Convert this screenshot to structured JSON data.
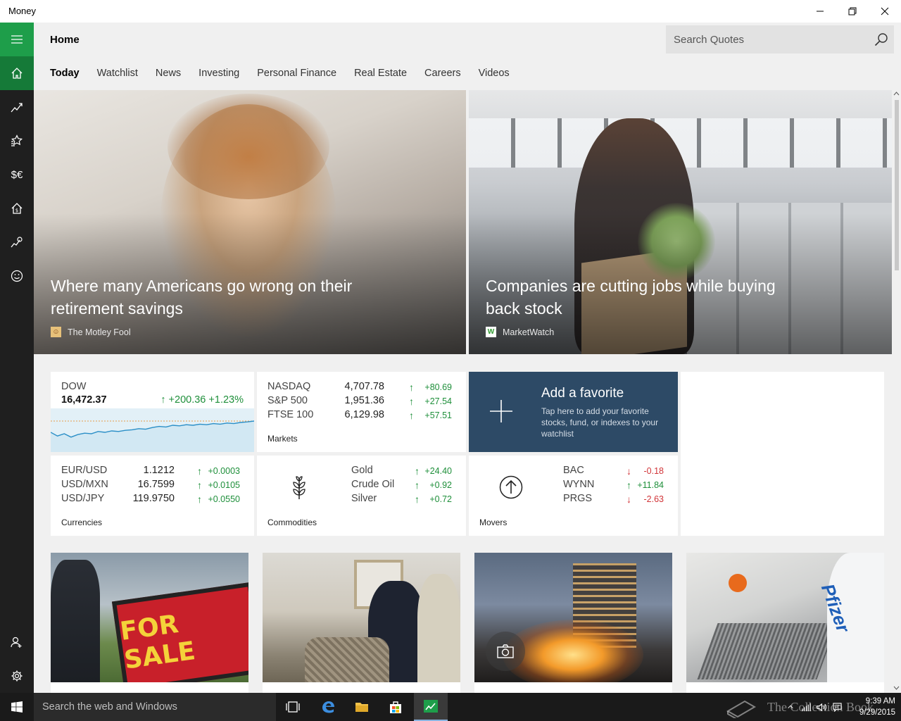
{
  "window": {
    "title": "Money"
  },
  "header": {
    "page_title": "Home"
  },
  "search": {
    "placeholder": "Search Quotes"
  },
  "tabs": [
    {
      "label": "Today",
      "active": true
    },
    {
      "label": "Watchlist"
    },
    {
      "label": "News"
    },
    {
      "label": "Investing"
    },
    {
      "label": "Personal Finance"
    },
    {
      "label": "Real Estate"
    },
    {
      "label": "Careers"
    },
    {
      "label": "Videos"
    }
  ],
  "hero": [
    {
      "headline": "Where many Americans go wrong on their retirement savings",
      "source": "The Motley Fool"
    },
    {
      "headline": "Companies are cutting jobs while buying back stock",
      "source": "MarketWatch"
    }
  ],
  "dow": {
    "name": "DOW",
    "value": "16,472.37",
    "change": "+200.36",
    "percent": "+1.23%",
    "sparkline": [
      0.55,
      0.42,
      0.5,
      0.38,
      0.47,
      0.52,
      0.5,
      0.58,
      0.55,
      0.6,
      0.58,
      0.62,
      0.64,
      0.68,
      0.66,
      0.72,
      0.76,
      0.74,
      0.8,
      0.78,
      0.82,
      0.8,
      0.84,
      0.82,
      0.86,
      0.84,
      0.88,
      0.86,
      0.9,
      0.92,
      0.95
    ]
  },
  "markets": {
    "caption": "Markets",
    "rows": [
      {
        "name": "NASDAQ",
        "value": "4,707.78",
        "change": "+80.69",
        "dir": "up"
      },
      {
        "name": "S&P 500",
        "value": "1,951.36",
        "change": "+27.54",
        "dir": "up"
      },
      {
        "name": "FTSE 100",
        "value": "6,129.98",
        "change": "+57.51",
        "dir": "up"
      }
    ]
  },
  "favorite": {
    "title": "Add a favorite",
    "description": "Tap here to add your favorite stocks, fund, or indexes to your watchlist"
  },
  "currencies": {
    "caption": "Currencies",
    "rows": [
      {
        "name": "EUR/USD",
        "value": "1.1212",
        "change": "+0.0003",
        "dir": "up"
      },
      {
        "name": "USD/MXN",
        "value": "16.7599",
        "change": "+0.0105",
        "dir": "up"
      },
      {
        "name": "USD/JPY",
        "value": "119.9750",
        "change": "+0.0550",
        "dir": "up"
      }
    ]
  },
  "commodities": {
    "caption": "Commodities",
    "rows": [
      {
        "name": "Gold",
        "change": "+24.40",
        "dir": "up"
      },
      {
        "name": "Crude Oil",
        "change": "+0.92",
        "dir": "up"
      },
      {
        "name": "Silver",
        "change": "+0.72",
        "dir": "up"
      }
    ]
  },
  "movers": {
    "caption": "Movers",
    "rows": [
      {
        "name": "BAC",
        "change": "-0.18",
        "dir": "down"
      },
      {
        "name": "WYNN",
        "change": "+11.84",
        "dir": "up"
      },
      {
        "name": "PRGS",
        "change": "-2.63",
        "dir": "down"
      }
    ]
  },
  "thumbs": [
    {
      "sign_text": "FOR SALE"
    },
    {},
    {},
    {
      "logo_text": "Pfizer"
    }
  ],
  "taskbar": {
    "search_placeholder": "Search the web and Windows",
    "time": "9:39 AM",
    "date": "9/29/2015",
    "watermark": "The Collection Book"
  },
  "colors": {
    "accent": "#1e9e4a",
    "up": "#1e8f3a",
    "down": "#d13438",
    "favorite_tile": "#2d4a66"
  }
}
